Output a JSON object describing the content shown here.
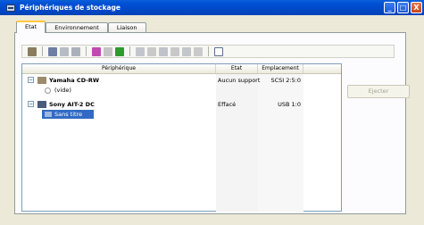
{
  "window": {
    "title": "Périphériques de stockage"
  },
  "title_buttons": {
    "minimize": "_",
    "maximize": "□",
    "close": "X"
  },
  "tabs": [
    {
      "label": "Etat",
      "active": true
    },
    {
      "label": "Environnement",
      "active": false
    },
    {
      "label": "Liaison",
      "active": false
    }
  ],
  "toolbar": {
    "icons": [
      "properties-icon",
      "info-icon",
      "hide-icon",
      "eject-icon",
      "erase-icon",
      "close-session-icon",
      "add-icon",
      "cut-icon",
      "copy-icon",
      "paste-icon",
      "compare-icon",
      "transfer-icon",
      "format-icon",
      "help-icon"
    ]
  },
  "table": {
    "headers": {
      "device": "Périphérique",
      "status": "Etat",
      "location": "Emplacement"
    },
    "rows": [
      {
        "name": "Yamaha CD-RW",
        "status": "Aucun support",
        "location": "SCSI 2:5:0"
      },
      {
        "name": "(vide)",
        "status": "",
        "location": ""
      },
      {
        "name": "Sony AIT-2 DC",
        "status": "Effacé",
        "location": "USB 1:0"
      },
      {
        "name": "Sans titre",
        "status": "",
        "location": ""
      }
    ]
  },
  "eject_button": {
    "label": "Ejecter"
  }
}
